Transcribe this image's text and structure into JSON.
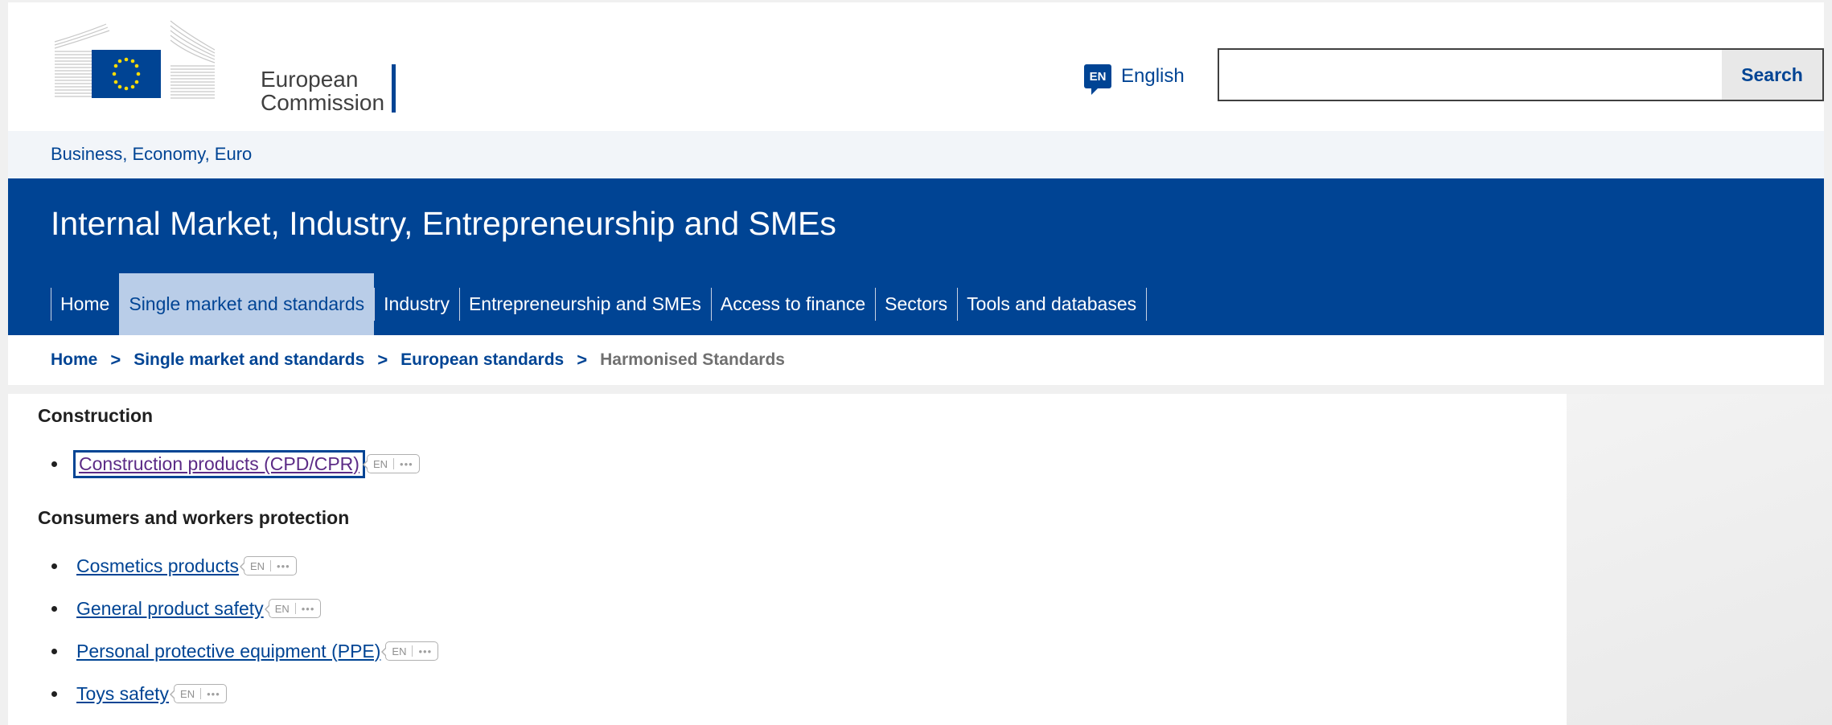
{
  "header": {
    "logo_line1": "European",
    "logo_line2": "Commission",
    "language_code": "EN",
    "language_label": "English",
    "search_placeholder": "",
    "search_value": "",
    "search_button_label": "Search"
  },
  "site_strip": {
    "link": "Business, Economy, Euro"
  },
  "banner": {
    "title": "Internal Market, Industry, Entrepreneurship and SMEs",
    "nav": [
      {
        "label": "Home"
      },
      {
        "label": "Single market and standards",
        "active": true
      },
      {
        "label": "Industry"
      },
      {
        "label": "Entrepreneurship and SMEs"
      },
      {
        "label": "Access to finance"
      },
      {
        "label": "Sectors"
      },
      {
        "label": "Tools and databases"
      }
    ]
  },
  "breadcrumb": {
    "items": [
      "Home",
      "Single market and standards",
      "European standards",
      "Harmonised Standards"
    ],
    "separator": ">"
  },
  "content": {
    "sections": [
      {
        "title": "Construction",
        "items": [
          {
            "label": "Construction products (CPD/CPR)",
            "lang": "EN",
            "more": "•••"
          }
        ]
      },
      {
        "title": "Consumers and workers protection",
        "items": [
          {
            "label": "Cosmetics products",
            "lang": "EN",
            "more": "•••"
          },
          {
            "label": "General product safety",
            "lang": "EN",
            "more": "•••"
          },
          {
            "label": "Personal protective equipment (PPE)",
            "lang": "EN",
            "more": "•••"
          },
          {
            "label": "Toys safety",
            "lang": "EN",
            "more": "•••"
          }
        ]
      }
    ]
  },
  "colors": {
    "brand_blue": "#004494",
    "nav_active_bg": "#b9cde8",
    "visited_link": "#5c2b86"
  }
}
